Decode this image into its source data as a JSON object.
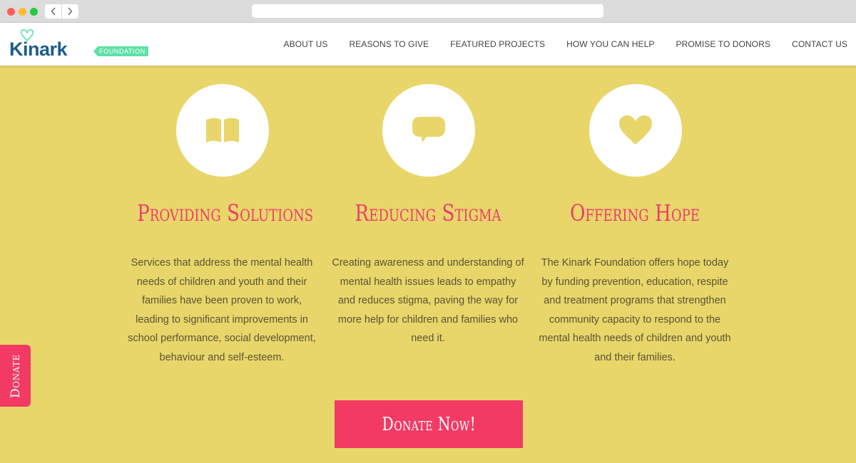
{
  "browser": {
    "back_label": "‹",
    "forward_label": "›"
  },
  "brand": {
    "name": "Kinark",
    "tag": "FOUNDATION",
    "primary_color": "#1b5e8c",
    "tag_color": "#5fe0a8"
  },
  "nav": {
    "items": [
      {
        "label": "ABOUT US"
      },
      {
        "label": "REASONS TO GIVE"
      },
      {
        "label": "FEATURED PROJECTS"
      },
      {
        "label": "HOW YOU CAN HELP"
      },
      {
        "label": "PROMISE TO DONORS"
      },
      {
        "label": "CONTACT US"
      }
    ]
  },
  "theme": {
    "background": "#e8d66a",
    "accent": "#f23a64"
  },
  "features": [
    {
      "icon": "book-icon",
      "title": "Providing Solutions",
      "text": "Services that address the mental health needs of children and youth and their families have been proven to work, leading to significant improvements in school performance, social development, behaviour and self-esteem."
    },
    {
      "icon": "speech-bubble-icon",
      "title": "Reducing Stigma",
      "text": "Creating awareness and understanding of mental health issues leads to empathy and reduces stigma, paving the way for more help for children and families who need it."
    },
    {
      "icon": "heart-icon",
      "title": "Offering Hope",
      "text": "The Kinark Foundation offers hope today by funding prevention, education, respite and treatment programs that strengthen community capacity to respond to the mental health needs of children and youth and their families."
    }
  ],
  "cta": {
    "donate_now_label": "Donate Now!",
    "donate_tab_label": "Donate"
  }
}
